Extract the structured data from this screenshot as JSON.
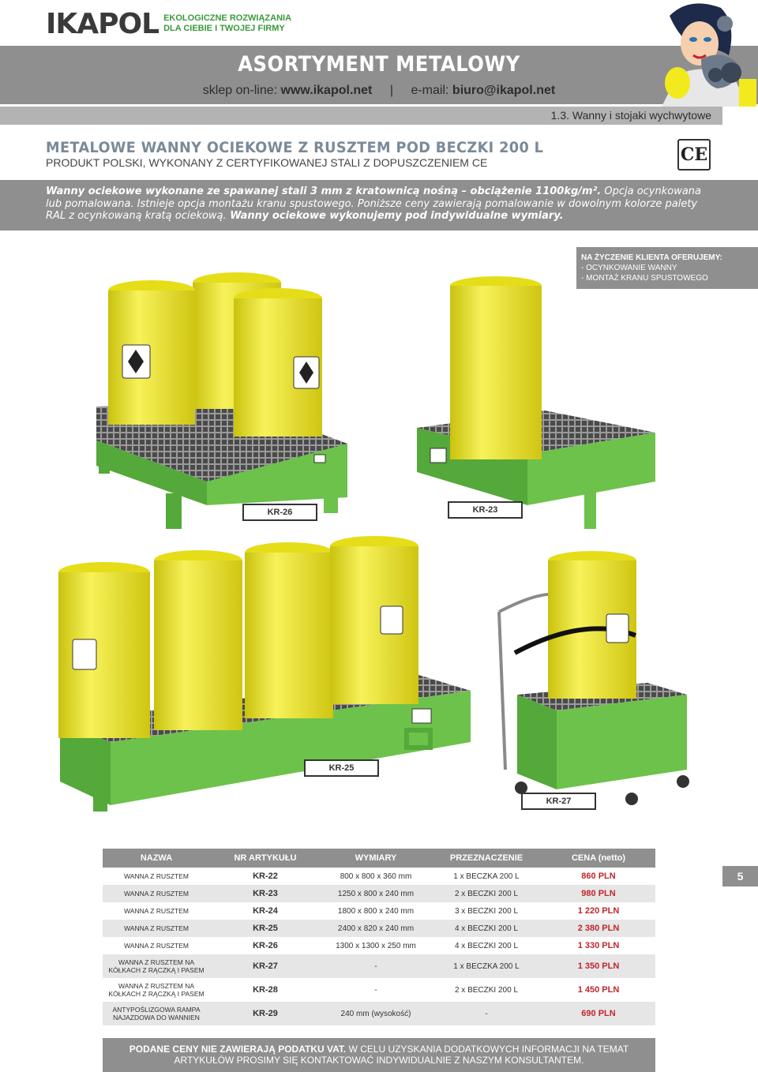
{
  "header": {
    "logo": "IKAPOL",
    "tagline_1": "EKOLOGICZNE ROZWIĄZANIA",
    "tagline_2": "DLA CIEBIE I TWOJEJ FIRMY",
    "title": "ASORTYMENT METALOWY",
    "shop_label": "sklep on-line:",
    "shop_url": "www.ikapol.net",
    "separator": "|",
    "email_label": "e-mail:",
    "email": "biuro@ikapol.net",
    "section": "1.3. Wanny i stojaki wychwytowe"
  },
  "product": {
    "title": "METALOWE WANNY OCIEKOWE Z RUSZTEM POD BECZKI 200 L",
    "subtitle": "PRODUKT POLSKI, WYKONANY Z CERTYFIKOWANEJ STALI Z DOPUSZCZENIEM CE",
    "ce_mark": "CE"
  },
  "description": {
    "bold_1": "Wanny ociekowe wykonane ze spawanej stali 3 mm z kratownicą nośną – obciążenie 1100kg/m².",
    "text_1": " Opcja ocynkowana lub pomalowana. Istnieje opcja montażu kranu spustowego. Poniższe ceny zawierają pomalowanie w dowolnym kolorze palety RAL z ocynkowaną kratą ociekową.",
    "bold_2": " Wanny ociekowe wykonujemy pod indywidualne wymiary."
  },
  "options": {
    "heading": "NA ŻYCZENIE KLIENTA OFERUJEMY:",
    "item_1": "- OCYNKOWANIE WANNY",
    "item_2": "- MONTAŻ KRANU SPUSTOWEGO"
  },
  "product_labels": {
    "kr26": "KR-26",
    "kr23": "KR-23",
    "kr25": "KR-25",
    "kr27": "KR-27"
  },
  "colors": {
    "tray_green": "#6cc24a",
    "barrel_yellow": "#f2ea1d",
    "header_grey": "#8f8f8f",
    "price_red": "#c0262c"
  },
  "table": {
    "headers": [
      "NAZWA",
      "NR ARTYKUŁU",
      "WYMIARY",
      "PRZEZNACZENIE",
      "CENA (netto)"
    ],
    "rows": [
      {
        "name": "WANNA Z RUSZTEM",
        "code": "KR-22",
        "dims": "800 x 800 x 360 mm",
        "capacity": "1 x BECZKA 200 L",
        "price": "860 PLN"
      },
      {
        "name": "WANNA Z RUSZTEM",
        "code": "KR-23",
        "dims": "1250 x 800 x 240 mm",
        "capacity": "2 x BECZKI 200 L",
        "price": "980 PLN"
      },
      {
        "name": "WANNA Z RUSZTEM",
        "code": "KR-24",
        "dims": "1800 x 800 x 240 mm",
        "capacity": "3 x BECZKI 200 L",
        "price": "1 220 PLN"
      },
      {
        "name": "WANNA Z RUSZTEM",
        "code": "KR-25",
        "dims": "2400 x 820 x 240 mm",
        "capacity": "4 x BECZKI 200 L",
        "price": "2 380 PLN"
      },
      {
        "name": "WANNA Z RUSZTEM",
        "code": "KR-26",
        "dims": "1300 x 1300 x 250 mm",
        "capacity": "4 x BECZKI 200 L",
        "price": "1 330 PLN"
      },
      {
        "name": "WANNA Z RUSZTEM NA KÓŁKACH Z RĄCZKĄ I PASEM",
        "code": "KR-27",
        "dims": "-",
        "capacity": "1 x BECZKA 200 L",
        "price": "1 350 PLN"
      },
      {
        "name": "WANNA Z RUSZTEM NA KÓŁKACH Z RĄCZKĄ I PASEM",
        "code": "KR-28",
        "dims": "-",
        "capacity": "2 x BECZKI 200 L",
        "price": "1 450 PLN"
      },
      {
        "name": "ANTYPOŚLIZGOWA RAMPA NAJAZDOWA DO WANNIEN",
        "code": "KR-29",
        "dims": "240 mm (wysokość)",
        "capacity": "-",
        "price": "690 PLN"
      }
    ]
  },
  "page_number": "5",
  "footer": {
    "bold": "PODANE CENY NIE ZAWIERAJĄ PODATKU VAT.",
    "text": " W CELU UZYSKANIA DODATKOWYCH INFORMACJI NA TEMAT ARTYKUŁÓW PROSIMY SIĘ KONTAKTOWAĆ INDYWIDUALNIE Z NASZYM KONSULTANTEM."
  }
}
